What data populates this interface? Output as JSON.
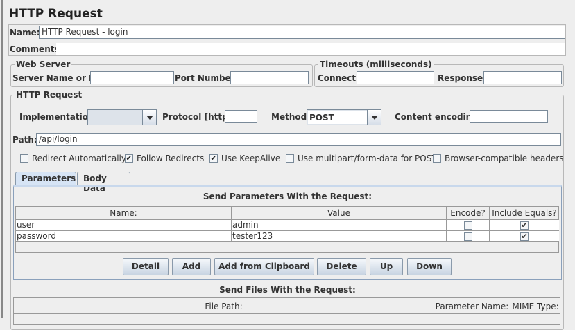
{
  "title": "HTTP Request",
  "name_label": "Name:",
  "name_value": "HTTP Request - login",
  "comments_label": "Comments:",
  "comments_value": "",
  "web_server": {
    "legend": "Web Server",
    "server_label": "Server Name or IP:",
    "server_value": "",
    "port_label": "Port Number:",
    "port_value": ""
  },
  "timeouts": {
    "legend": "Timeouts (milliseconds)",
    "connect_label": "Connect:",
    "connect_value": "",
    "response_label": "Response:",
    "response_value": ""
  },
  "http": {
    "legend": "HTTP Request",
    "impl_label": "Implementation:",
    "impl_value": "",
    "protocol_label": "Protocol [http]:",
    "protocol_value": "",
    "method_label": "Method:",
    "method_value": "POST",
    "encoding_label": "Content encoding:",
    "encoding_value": "",
    "path_label": "Path:",
    "path_value": "/api/login"
  },
  "checkboxes": [
    {
      "label": "Redirect Automatically",
      "checked": false
    },
    {
      "label": "Follow Redirects",
      "checked": true
    },
    {
      "label": "Use KeepAlive",
      "checked": true
    },
    {
      "label": "Use multipart/form-data for POST",
      "checked": false
    },
    {
      "label": "Browser-compatible headers",
      "checked": false
    }
  ],
  "tabs": [
    {
      "label": "Parameters",
      "selected": true
    },
    {
      "label": "Body Data",
      "selected": false
    }
  ],
  "params": {
    "title": "Send Parameters With the Request:",
    "columns": [
      "Name:",
      "Value",
      "Encode?",
      "Include Equals?"
    ],
    "rows": [
      {
        "name": "user",
        "value": "admin",
        "encode": false,
        "include_equals": true
      },
      {
        "name": "password",
        "value": "tester123",
        "encode": false,
        "include_equals": true
      }
    ]
  },
  "buttons": [
    "Detail",
    "Add",
    "Add from Clipboard",
    "Delete",
    "Up",
    "Down"
  ],
  "files": {
    "title": "Send Files With the Request:",
    "columns": [
      "File Path:",
      "Parameter Name:",
      "MIME Type:"
    ]
  },
  "check_mark": "✔"
}
